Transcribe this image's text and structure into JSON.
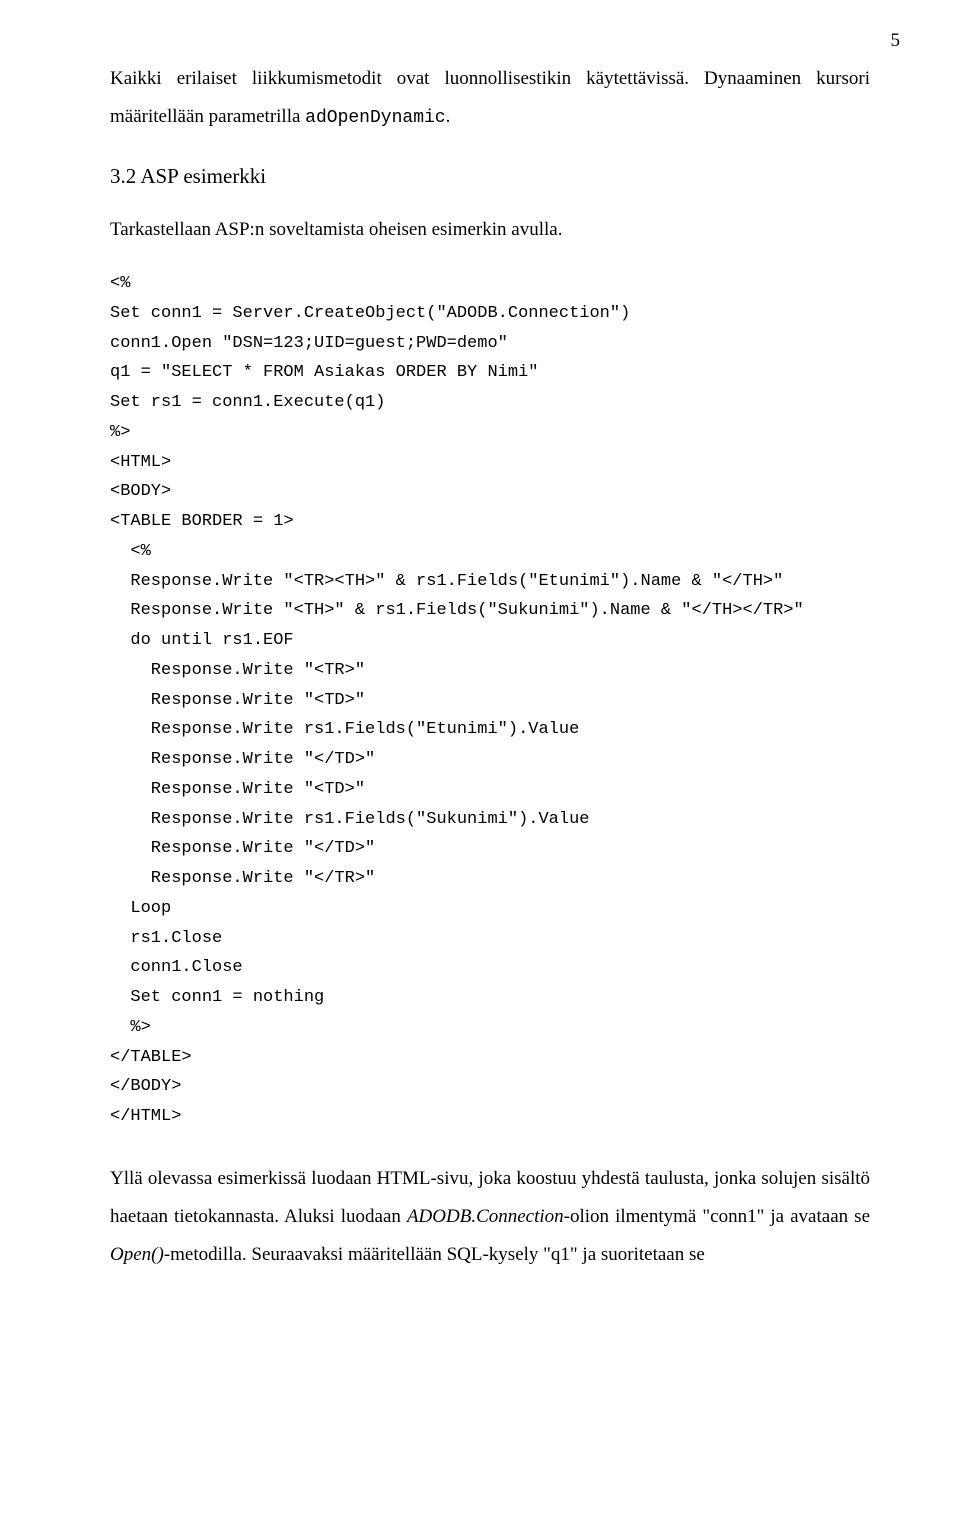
{
  "pageNumber": "5",
  "para1_a": "Kaikki erilaiset liikkumismetodit ovat luonnollisestikin käytettävissä. Dynaaminen kursori määritellään parametrilla ",
  "para1_code": "adOpenDynamic",
  "para1_b": ".",
  "heading": "3.2 ASP esimerkki",
  "para2": "Tarkastellaan ASP:n soveltamista oheisen esimerkin avulla.",
  "code": "<%\nSet conn1 = Server.CreateObject(\"ADODB.Connection\")\nconn1.Open \"DSN=123;UID=guest;PWD=demo\"\nq1 = \"SELECT * FROM Asiakas ORDER BY Nimi\"\nSet rs1 = conn1.Execute(q1)\n%>\n<HTML>\n<BODY>\n<TABLE BORDER = 1>\n  <%\n  Response.Write \"<TR><TH>\" & rs1.Fields(\"Etunimi\").Name & \"</TH>\"\n  Response.Write \"<TH>\" & rs1.Fields(\"Sukunimi\").Name & \"</TH></TR>\"\n  do until rs1.EOF\n    Response.Write \"<TR>\"\n    Response.Write \"<TD>\"\n    Response.Write rs1.Fields(\"Etunimi\").Value\n    Response.Write \"</TD>\"\n    Response.Write \"<TD>\"\n    Response.Write rs1.Fields(\"Sukunimi\").Value\n    Response.Write \"</TD>\"\n    Response.Write \"</TR>\"\n  Loop\n  rs1.Close\n  conn1.Close\n  Set conn1 = nothing\n  %>\n</TABLE>\n</BODY>\n</HTML>",
  "para3_a": "Yllä olevassa esimerkissä luodaan HTML-sivu, joka koostuu yhdestä taulusta, jonka solujen sisältö haetaan tietokannasta. Aluksi luodaan ",
  "para3_i1": "ADODB.Connection",
  "para3_b": "-olion ilmentymä \"conn1\" ja avataan se ",
  "para3_i2": "Open()",
  "para3_c": "-metodilla. Seuraavaksi määritellään SQL-kysely \"q1\" ja suoritetaan se"
}
